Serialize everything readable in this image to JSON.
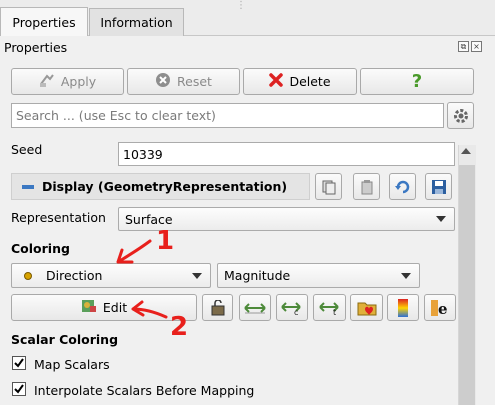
{
  "tabs": [
    {
      "label": "Properties",
      "active": true
    },
    {
      "label": "Information",
      "active": false
    }
  ],
  "panel": {
    "title": "Properties"
  },
  "actions": {
    "apply": "Apply",
    "reset": "Reset",
    "delete": "Delete",
    "help": "?"
  },
  "search": {
    "placeholder": "Search ... (use Esc to clear text)"
  },
  "seed": {
    "label": "Seed",
    "value": "10339"
  },
  "display": {
    "title": "Display (GeometryRepresentation)"
  },
  "representation": {
    "label": "Representation",
    "value": "Surface"
  },
  "coloring": {
    "title": "Coloring",
    "array": "Direction",
    "component": "Magnitude",
    "edit": "Edit"
  },
  "scalar_coloring": {
    "title": "Scalar Coloring",
    "map_scalars": {
      "label": "Map Scalars",
      "checked": true
    },
    "interpolate": {
      "label": "Interpolate Scalars Before Mapping",
      "checked": true
    }
  },
  "annotations": {
    "one": "1",
    "two": "2",
    "color": "#e8201c"
  },
  "colors": {
    "accent_blue": "#3b78c2",
    "delete_red": "#d22"
  }
}
